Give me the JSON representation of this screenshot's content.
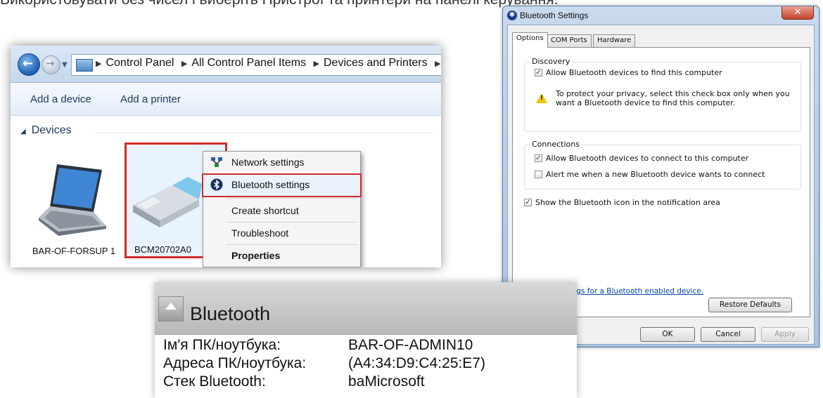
{
  "page_top_text": "Використовувати без чисел і виберіть Пристрої та принтери на панелі керування.",
  "explorer": {
    "breadcrumbs": [
      "Control Panel",
      "All Control Panel Items",
      "Devices and Printers"
    ],
    "toolbar": {
      "add_device": "Add a device",
      "add_printer": "Add a printer"
    },
    "section_header": "Devices",
    "devices": [
      {
        "label": "BAR-OF-FORSUP 1"
      },
      {
        "label": "BCM20702A0"
      }
    ],
    "context_menu": [
      {
        "label": "Network settings",
        "icon": "network-icon"
      },
      {
        "label": "Bluetooth settings",
        "icon": "bluetooth-icon",
        "highlighted": true
      },
      {
        "label": "Create shortcut"
      },
      {
        "label": "Troubleshoot"
      },
      {
        "label": "Properties",
        "bold": true
      }
    ]
  },
  "dialog": {
    "title": "Bluetooth Settings",
    "close": "✕",
    "tabs": [
      "Options",
      "COM Ports",
      "Hardware"
    ],
    "discovery": {
      "title": "Discovery",
      "allow_find": {
        "label": "Allow Bluetooth devices to find this computer",
        "checked": true
      },
      "warning": "To protect your privacy, select this check box only when you want a Bluetooth device to find this computer."
    },
    "connections": {
      "title": "Connections",
      "allow_connect": {
        "label": "Allow Bluetooth devices to connect to this computer",
        "checked": true
      },
      "alert_new": {
        "label": "Alert me when a new Bluetooth device wants to connect",
        "checked": false
      }
    },
    "show_icon": {
      "label": "Show the Bluetooth icon in the notification area",
      "checked": true
    },
    "change_link": "Change settings for a Bluetooth enabled device.",
    "buttons": {
      "restore": "Restore Defaults",
      "ok": "OK",
      "cancel": "Cancel",
      "apply": "Apply"
    }
  },
  "info_panel": {
    "title": "Bluetooth",
    "rows": [
      {
        "label": "Ім'я ПК/ноутбука:",
        "value": "BAR-OF-ADMIN10"
      },
      {
        "label": "Адреса ПК/ноутбука:",
        "value": "(A4:34:D9:C4:25:E7)"
      },
      {
        "label": "Стек Bluetooth:",
        "value": "baMicrosoft"
      }
    ]
  },
  "colors": {
    "highlight_border": "#d42a2a",
    "link": "#0645ad",
    "title_bar": "#c9daed"
  }
}
